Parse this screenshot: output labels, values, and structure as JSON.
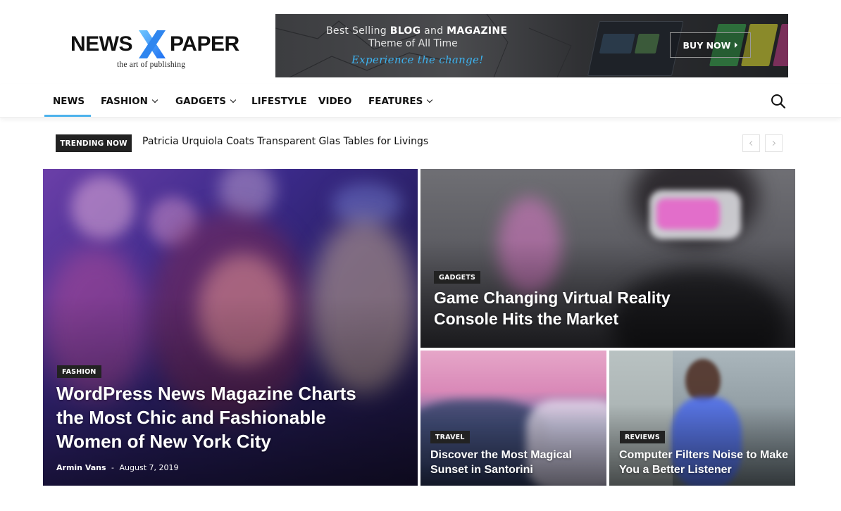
{
  "logo": {
    "word_left": "NEWS",
    "word_right": "PAPER",
    "tagline": "the art of publishing",
    "icon": "x-logo-icon"
  },
  "banner": {
    "line1_prefix": "Best Selling ",
    "line1_bold1": "BLOG",
    "line1_mid": " and ",
    "line1_bold2": "MAGAZINE",
    "line2": "Theme of All Time",
    "line3": "Experience the change!",
    "button": "BUY NOW"
  },
  "nav": {
    "items": [
      {
        "label": "NEWS",
        "dropdown": false,
        "active": true
      },
      {
        "label": "FASHION",
        "dropdown": true
      },
      {
        "label": "GADGETS",
        "dropdown": true
      },
      {
        "label": "LIFESTYLE",
        "dropdown": false
      },
      {
        "label": "VIDEO",
        "dropdown": false
      },
      {
        "label": "FEATURES",
        "dropdown": true
      }
    ],
    "search_icon": "search-icon",
    "accent": "#4db2ec"
  },
  "trending": {
    "label": "TRENDING NOW",
    "headline": "Patricia Urquiola Coats Transparent Glas Tables for Livings"
  },
  "tiles": {
    "main": {
      "category": "FASHION",
      "title_l1": "WordPress News Magazine Charts",
      "title_l2": "the Most Chic and Fashionable",
      "title_l3": "Women of New York City",
      "author": "Armin Vans",
      "separator": "-",
      "date": "August 7, 2019"
    },
    "top_right": {
      "category": "GADGETS",
      "title_l1": "Game Changing Virtual Reality",
      "title_l2": "Console Hits the Market"
    },
    "bottom_left": {
      "category": "TRAVEL",
      "title_l1": "Discover the Most Magical",
      "title_l2": "Sunset in Santorini"
    },
    "bottom_right": {
      "category": "REVIEWS",
      "title_l1": "Computer Filters Noise to Make",
      "title_l2": "You a Better Listener"
    }
  }
}
